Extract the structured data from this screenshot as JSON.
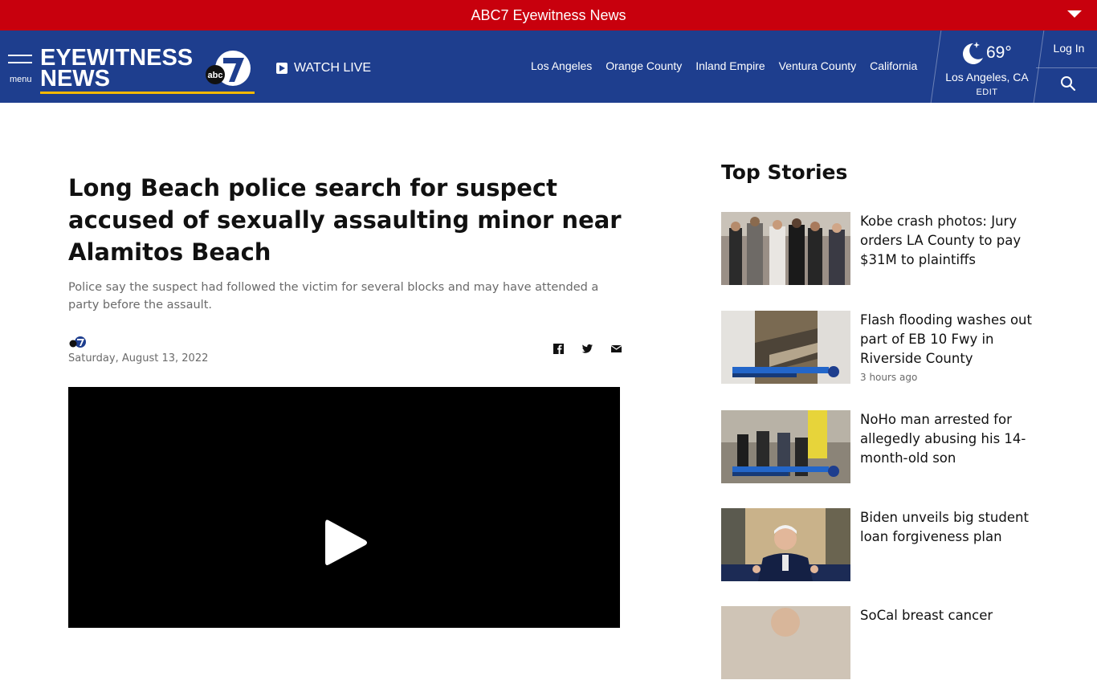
{
  "banner": {
    "title": "ABC7 Eyewitness News"
  },
  "header": {
    "menu_label": "menu",
    "logo_line1": "EYEWITNESS",
    "logo_line2": "NEWS",
    "watch_live": "WATCH LIVE",
    "nav": [
      "Los Angeles",
      "Orange County",
      "Inland Empire",
      "Ventura County",
      "California"
    ],
    "weather": {
      "temp": "69°",
      "location": "Los Angeles, CA",
      "edit": "EDIT"
    },
    "login": "Log In"
  },
  "article": {
    "headline": "Long Beach police search for suspect accused of sexually assaulting minor near Alamitos Beach",
    "dek": "Police say the suspect had followed the victim for several blocks and may have attended a party before the assault.",
    "date": "Saturday, August 13, 2022"
  },
  "sidebar": {
    "heading": "Top Stories",
    "stories": [
      {
        "title": "Kobe crash photos: Jury orders LA County to pay $31M to plaintiffs",
        "time": ""
      },
      {
        "title": "Flash flooding washes out part of EB 10 Fwy in Riverside County",
        "time": "3 hours ago"
      },
      {
        "title": "NoHo man arrested for allegedly abusing his 14-month-old son",
        "time": ""
      },
      {
        "title": "Biden unveils big student loan forgiveness plan",
        "time": ""
      },
      {
        "title": "SoCal breast cancer",
        "time": ""
      }
    ]
  },
  "colors": {
    "banner_red": "#c8000d",
    "header_blue": "#1e3e8e",
    "logo_gold": "#f5b800"
  }
}
